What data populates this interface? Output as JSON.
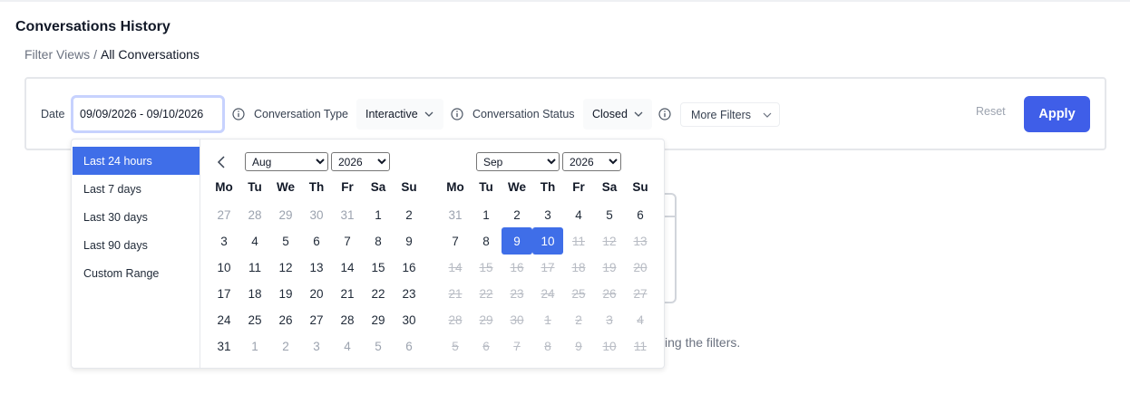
{
  "page": {
    "title": "Conversations History"
  },
  "breadcrumb": {
    "parent": "Filter Views",
    "separator": "/",
    "current": "All Conversations"
  },
  "filters": {
    "date_label": "Date",
    "date_value": "09/09/2026 - 09/10/2026",
    "type_label": "Conversation Type",
    "type_value": "Interactive",
    "status_label": "Conversation Status",
    "status_value": "Closed",
    "more_label": "More Filters",
    "reset_label": "Reset",
    "apply_label": "Apply"
  },
  "background_hint": "ing the filters.",
  "picker": {
    "ranges": [
      "Last 24 hours",
      "Last 7 days",
      "Last 30 days",
      "Last 90 days",
      "Custom Range"
    ],
    "active_range": "Last 24 hours",
    "weekdays": [
      "Mo",
      "Tu",
      "We",
      "Th",
      "Fr",
      "Sa",
      "Su"
    ],
    "left": {
      "month": "Aug",
      "year": "2026",
      "weeks": [
        [
          {
            "d": "27",
            "s": "off"
          },
          {
            "d": "28",
            "s": "off"
          },
          {
            "d": "29",
            "s": "off"
          },
          {
            "d": "30",
            "s": "off"
          },
          {
            "d": "31",
            "s": "off"
          },
          {
            "d": "1"
          },
          {
            "d": "2"
          }
        ],
        [
          {
            "d": "3"
          },
          {
            "d": "4"
          },
          {
            "d": "5"
          },
          {
            "d": "6"
          },
          {
            "d": "7"
          },
          {
            "d": "8"
          },
          {
            "d": "9"
          }
        ],
        [
          {
            "d": "10"
          },
          {
            "d": "11"
          },
          {
            "d": "12"
          },
          {
            "d": "13"
          },
          {
            "d": "14"
          },
          {
            "d": "15"
          },
          {
            "d": "16"
          }
        ],
        [
          {
            "d": "17"
          },
          {
            "d": "18"
          },
          {
            "d": "19"
          },
          {
            "d": "20"
          },
          {
            "d": "21"
          },
          {
            "d": "22"
          },
          {
            "d": "23"
          }
        ],
        [
          {
            "d": "24"
          },
          {
            "d": "25"
          },
          {
            "d": "26"
          },
          {
            "d": "27"
          },
          {
            "d": "28"
          },
          {
            "d": "29"
          },
          {
            "d": "30"
          }
        ],
        [
          {
            "d": "31"
          },
          {
            "d": "1",
            "s": "off"
          },
          {
            "d": "2",
            "s": "off"
          },
          {
            "d": "3",
            "s": "off"
          },
          {
            "d": "4",
            "s": "off"
          },
          {
            "d": "5",
            "s": "off"
          },
          {
            "d": "6",
            "s": "off"
          }
        ]
      ]
    },
    "right": {
      "month": "Sep",
      "year": "2026",
      "weeks": [
        [
          {
            "d": "31",
            "s": "off"
          },
          {
            "d": "1"
          },
          {
            "d": "2"
          },
          {
            "d": "3"
          },
          {
            "d": "4"
          },
          {
            "d": "5"
          },
          {
            "d": "6"
          }
        ],
        [
          {
            "d": "7"
          },
          {
            "d": "8"
          },
          {
            "d": "9",
            "s": "selected"
          },
          {
            "d": "10",
            "s": "selected"
          },
          {
            "d": "11",
            "s": "disabled"
          },
          {
            "d": "12",
            "s": "disabled"
          },
          {
            "d": "13",
            "s": "disabled"
          }
        ],
        [
          {
            "d": "14",
            "s": "disabled"
          },
          {
            "d": "15",
            "s": "disabled"
          },
          {
            "d": "16",
            "s": "disabled"
          },
          {
            "d": "17",
            "s": "disabled"
          },
          {
            "d": "18",
            "s": "disabled"
          },
          {
            "d": "19",
            "s": "disabled"
          },
          {
            "d": "20",
            "s": "disabled"
          }
        ],
        [
          {
            "d": "21",
            "s": "disabled"
          },
          {
            "d": "22",
            "s": "disabled"
          },
          {
            "d": "23",
            "s": "disabled"
          },
          {
            "d": "24",
            "s": "disabled"
          },
          {
            "d": "25",
            "s": "disabled"
          },
          {
            "d": "26",
            "s": "disabled"
          },
          {
            "d": "27",
            "s": "disabled"
          }
        ],
        [
          {
            "d": "28",
            "s": "disabled"
          },
          {
            "d": "29",
            "s": "disabled"
          },
          {
            "d": "30",
            "s": "disabled"
          },
          {
            "d": "1",
            "s": "disabled"
          },
          {
            "d": "2",
            "s": "disabled"
          },
          {
            "d": "3",
            "s": "disabled"
          },
          {
            "d": "4",
            "s": "disabled"
          }
        ],
        [
          {
            "d": "5",
            "s": "disabled"
          },
          {
            "d": "6",
            "s": "disabled"
          },
          {
            "d": "7",
            "s": "disabled"
          },
          {
            "d": "8",
            "s": "disabled"
          },
          {
            "d": "9",
            "s": "disabled"
          },
          {
            "d": "10",
            "s": "disabled"
          },
          {
            "d": "11",
            "s": "disabled"
          }
        ]
      ]
    }
  },
  "colors": {
    "accent": "#3f6ee8",
    "apply_button": "#3f5ee8",
    "date_focus_border": "#c7d2fe",
    "card_border": "#e5e7eb",
    "disabled_day": "#b8bcc4"
  },
  "icons": {
    "info": "info-circle-icon",
    "chevron": "chevron-down-icon",
    "prev": "chevron-left-icon"
  }
}
